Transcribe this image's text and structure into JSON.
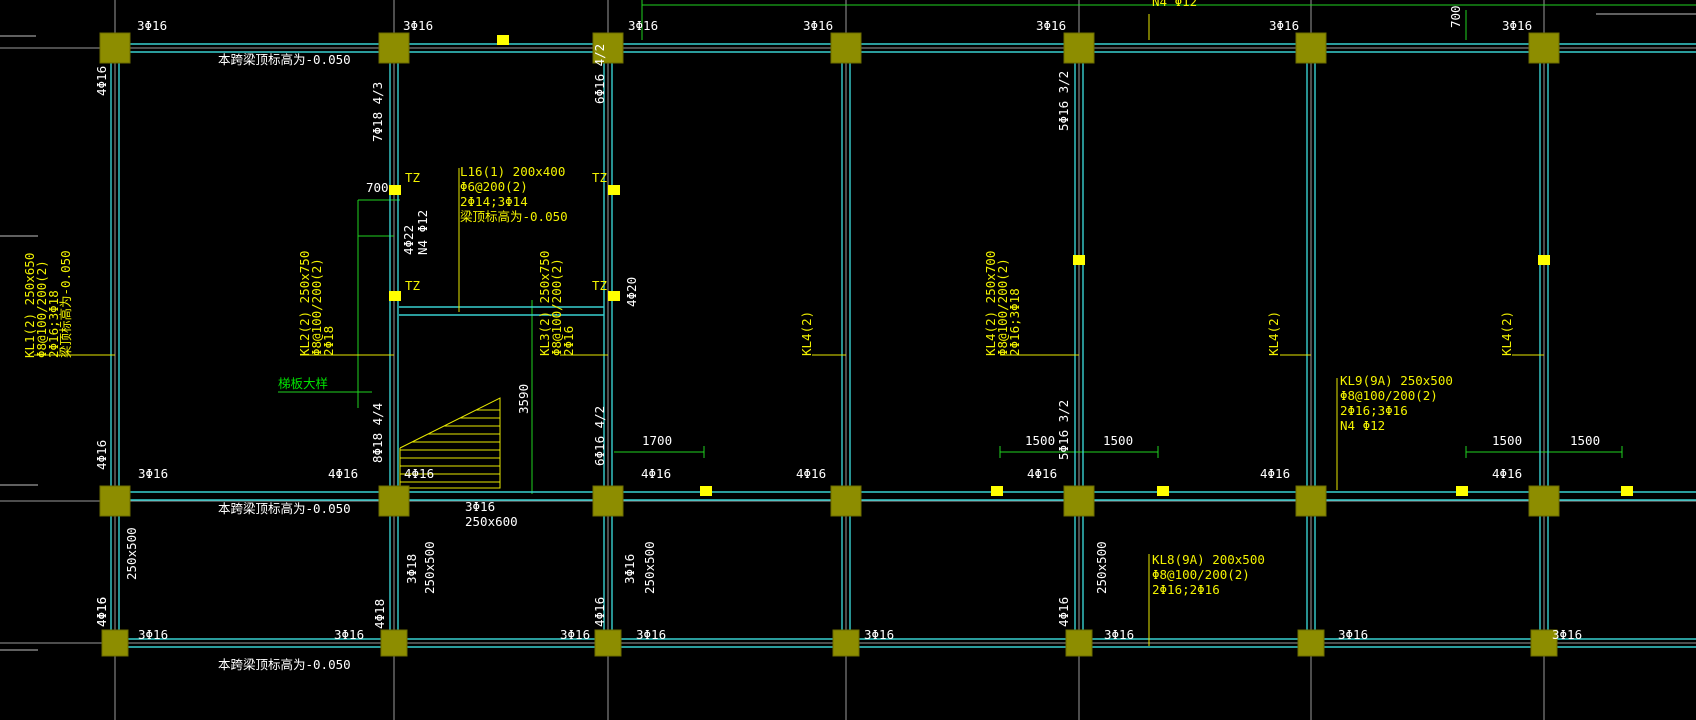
{
  "drawing": {
    "top_rebar_labels": [
      "3Φ16",
      "3Φ16",
      "3Φ16",
      "3Φ16",
      "3Φ16",
      "3Φ16",
      "3Φ16"
    ],
    "top_right_annotation": "N4 Φ12",
    "top_right_dim": "700",
    "elevation_note": "本跨梁顶标高为-0.050",
    "left_top_rebar": "4Φ16",
    "left_mid_rebar": "4Φ16",
    "left_bottom_rebar": "4Φ16",
    "kl1": [
      "KL1(2) 250x650",
      "Φ8@100/200(2)",
      "2Φ16;3Φ18",
      "梁顶标高为-0.050"
    ],
    "kl2": [
      "KL2(2) 250x750",
      "Φ8@100/200(2)",
      "2Φ18"
    ],
    "kl3": [
      "KL3(2) 250x750",
      "Φ8@100/200(2)",
      "2Φ16"
    ],
    "kl4_full": [
      "KL4(2) 250x700",
      "Φ8@100/200(2)",
      "2Φ16;3Φ18"
    ],
    "kl4_short": "KL4(2)",
    "l16": [
      "L16(1) 200x400",
      "Φ6@200(2)",
      "2Φ14;3Φ14",
      "梁顶标高为-0.050"
    ],
    "kl9": [
      "KL9(9A) 250x500",
      "Φ8@100/200(2)",
      "2Φ16;3Φ16",
      "N4 Φ12"
    ],
    "kl8": [
      "KL8(9A) 200x500",
      "Φ8@100/200(2)",
      "2Φ16;2Φ16"
    ],
    "stair_beam": [
      "3Φ16",
      "250x600"
    ],
    "tz": "TZ",
    "dim_700": "700",
    "dim_3590": "3590",
    "dim_1700": "1700",
    "dim_1500": "1500",
    "col2_a": "7Φ18 4/3",
    "col2_b": "4Φ22",
    "col2_c": "N4 Φ12",
    "col2_d": "8Φ18 4/4",
    "col3_a": "6Φ16 4/2",
    "col3_b": "4Φ20",
    "col3_c": "6Φ16 4/2",
    "col5_a": "5Φ16 3/2",
    "col5_b": "5Φ16 3/2",
    "stair_label": "梯板大样",
    "mid_rebar": [
      "3Φ16",
      "4Φ16",
      "4Φ16",
      "4Φ16",
      "4Φ16",
      "4Φ16",
      "4Φ16",
      "4Φ16"
    ],
    "low_rebar": [
      "3Φ16",
      "3Φ16",
      "3Φ16",
      "3Φ16",
      "3Φ16",
      "3Φ16",
      "3Φ16"
    ],
    "low_left": [
      "4Φ16",
      "4Φ18",
      "4Φ16",
      "4Φ16"
    ],
    "low_verts": [
      "250x500",
      "3Φ18",
      "250x500",
      "3Φ16",
      "250x500",
      "250x500"
    ]
  }
}
